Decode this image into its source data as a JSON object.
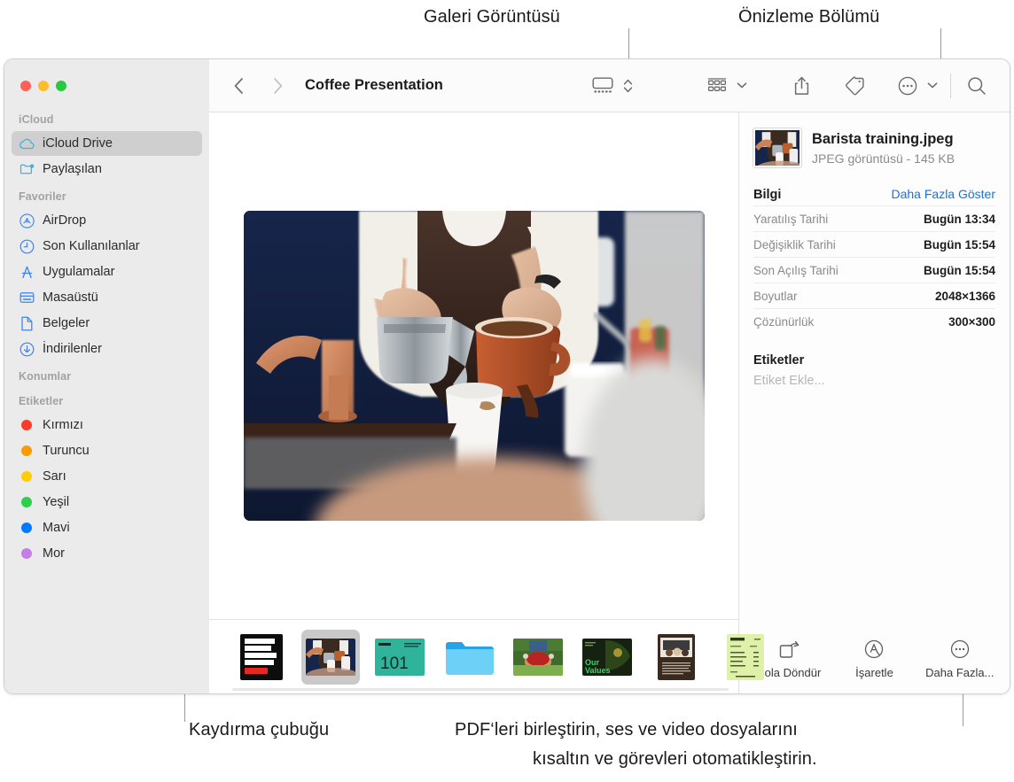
{
  "callouts": {
    "gallery_view": "Galeri Görüntüsü",
    "preview_pane": "Önizleme Bölümü",
    "scrollbar": "Kaydırma çubuğu",
    "bottom_right_line1": "PDF‘leri birleştirin, ses ve video dosyalarını",
    "bottom_right_line2": "kısaltın ve görevleri otomatikleştirin."
  },
  "window": {
    "title": "Coffee Presentation",
    "traffic_lights": [
      {
        "name": "close",
        "color": "#FF5F57"
      },
      {
        "name": "minimize",
        "color": "#FEBC2E"
      },
      {
        "name": "zoom",
        "color": "#28C840"
      }
    ]
  },
  "toolbar": {
    "back": "back-icon",
    "forward": "forward-icon",
    "view_gallery": "gallery-view-icon",
    "view_stepper": "view-stepper-icon",
    "group_by": "group-by-icon",
    "group_chevron": "chevron-down-icon",
    "share": "share-icon",
    "tag": "tag-icon",
    "more": "more-icon",
    "more_chevron": "chevron-down-icon",
    "search": "search-icon"
  },
  "sidebar": {
    "sections": [
      {
        "title": "iCloud",
        "items": [
          {
            "label": "iCloud Drive",
            "icon": "cloud-icon",
            "selected": true
          },
          {
            "label": "Paylaşılan",
            "icon": "shared-folder-icon",
            "selected": false
          }
        ]
      },
      {
        "title": "Favoriler",
        "items": [
          {
            "label": "AirDrop",
            "icon": "airdrop-icon",
            "selected": false
          },
          {
            "label": "Son Kullanılanlar",
            "icon": "clock-icon",
            "selected": false
          },
          {
            "label": "Uygulamalar",
            "icon": "applications-icon",
            "selected": false
          },
          {
            "label": "Masaüstü",
            "icon": "desktop-icon",
            "selected": false
          },
          {
            "label": "Belgeler",
            "icon": "document-icon",
            "selected": false
          },
          {
            "label": "İndirilenler",
            "icon": "downloads-icon",
            "selected": false
          }
        ]
      },
      {
        "title": "Konumlar",
        "items": []
      },
      {
        "title": "Etiketler",
        "items": [
          {
            "label": "Kırmızı",
            "icon": "tag-dot",
            "color": "#FC3B2D",
            "selected": false
          },
          {
            "label": "Turuncu",
            "icon": "tag-dot",
            "color": "#FB9A01",
            "selected": false
          },
          {
            "label": "Sarı",
            "icon": "tag-dot",
            "color": "#FFCC02",
            "selected": false
          },
          {
            "label": "Yeşil",
            "icon": "tag-dot",
            "color": "#2BD04B",
            "selected": false
          },
          {
            "label": "Mavi",
            "icon": "tag-dot",
            "color": "#007AFF",
            "selected": false
          },
          {
            "label": "Mor",
            "icon": "tag-dot",
            "color": "#C57EE8",
            "selected": false
          }
        ]
      }
    ]
  },
  "gallery": {
    "hero_alt": "Barista pouring milk and coffee into a cup",
    "thumbnails": [
      {
        "name": "growing-picking-roasting-brewing-coffee-poster",
        "selected": false
      },
      {
        "name": "barista-training-photo",
        "selected": true
      },
      {
        "name": "coffee-101-slide",
        "selected": false
      },
      {
        "name": "blue-folder",
        "selected": false
      },
      {
        "name": "cherry-harvest-photo",
        "selected": false
      },
      {
        "name": "our-values-slide",
        "selected": false
      },
      {
        "name": "meeting-document",
        "selected": false
      },
      {
        "name": "green-receipt-document",
        "selected": false
      }
    ]
  },
  "preview": {
    "file_name": "Barista training.jpeg",
    "file_subtitle": "JPEG görüntüsü - 145 KB",
    "info_heading": "Bilgi",
    "show_more_link": "Daha Fazla Göster",
    "metadata": [
      {
        "key": "Yaratılış Tarihi",
        "value": "Bugün 13:34"
      },
      {
        "key": "Değişiklik Tarihi",
        "value": "Bugün 15:54"
      },
      {
        "key": "Son Açılış Tarihi",
        "value": "Bugün 15:54"
      },
      {
        "key": "Boyutlar",
        "value": "2048×1366"
      },
      {
        "key": "Çözünürlük",
        "value": "300×300"
      }
    ],
    "tags_heading": "Etiketler",
    "tags_placeholder": "Etiket Ekle...",
    "actions": [
      {
        "label": "Sola Döndür",
        "icon": "rotate-left-icon"
      },
      {
        "label": "İşaretle",
        "icon": "markup-icon"
      },
      {
        "label": "Daha Fazla...",
        "icon": "more-icon"
      }
    ]
  },
  "colors": {
    "accent_link": "#1573e6",
    "sidebar_bg": "#ebebeb",
    "selection": "#cfcfcf"
  }
}
